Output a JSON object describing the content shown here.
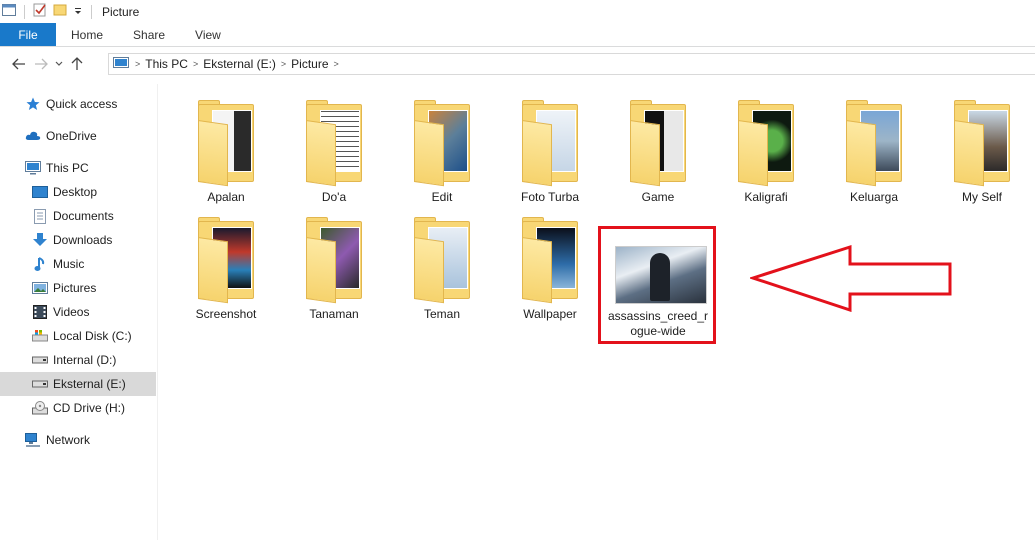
{
  "window": {
    "title": "Picture"
  },
  "ribbon": {
    "tabs": [
      "File",
      "Home",
      "Share",
      "View"
    ]
  },
  "address": {
    "crumbs": [
      "This PC",
      "Eksternal (E:)",
      "Picture"
    ]
  },
  "nav": {
    "items": [
      {
        "label": "Quick access",
        "icon": "star-icon",
        "indent": false,
        "selected": false
      },
      {
        "label": "OneDrive",
        "icon": "cloud-icon",
        "indent": false,
        "selected": false
      },
      {
        "label": "This PC",
        "icon": "computer-icon",
        "indent": false,
        "selected": false
      },
      {
        "label": "Desktop",
        "icon": "desktop-icon",
        "indent": true,
        "selected": false
      },
      {
        "label": "Documents",
        "icon": "document-icon",
        "indent": true,
        "selected": false
      },
      {
        "label": "Downloads",
        "icon": "download-icon",
        "indent": true,
        "selected": false
      },
      {
        "label": "Music",
        "icon": "music-icon",
        "indent": true,
        "selected": false
      },
      {
        "label": "Pictures",
        "icon": "picture-icon",
        "indent": true,
        "selected": false
      },
      {
        "label": "Videos",
        "icon": "video-icon",
        "indent": true,
        "selected": false
      },
      {
        "label": "Local Disk (C:)",
        "icon": "system-drive-icon",
        "indent": true,
        "selected": false
      },
      {
        "label": "Internal (D:)",
        "icon": "drive-icon",
        "indent": true,
        "selected": false
      },
      {
        "label": "Eksternal (E:)",
        "icon": "drive-icon",
        "indent": true,
        "selected": true
      },
      {
        "label": "CD Drive (H:)",
        "icon": "cd-drive-icon",
        "indent": true,
        "selected": false
      },
      {
        "label": "Network",
        "icon": "network-icon",
        "indent": false,
        "selected": false
      }
    ]
  },
  "content": {
    "folders": [
      "Apalan",
      "Do'a",
      "Edit",
      "Foto Turba",
      "Game",
      "Kaligrafi",
      "Keluarga",
      "My Self",
      "Screenshot",
      "Tanaman",
      "Teman",
      "Wallpaper"
    ],
    "file": {
      "label": "assassins_creed_rogue-wide",
      "label_line1": "assassins_creed_r",
      "label_line2": "ogue-wide"
    }
  },
  "colors": {
    "accent": "#1979ca",
    "folder": "#f8d775",
    "highlight": "#e3111b"
  }
}
